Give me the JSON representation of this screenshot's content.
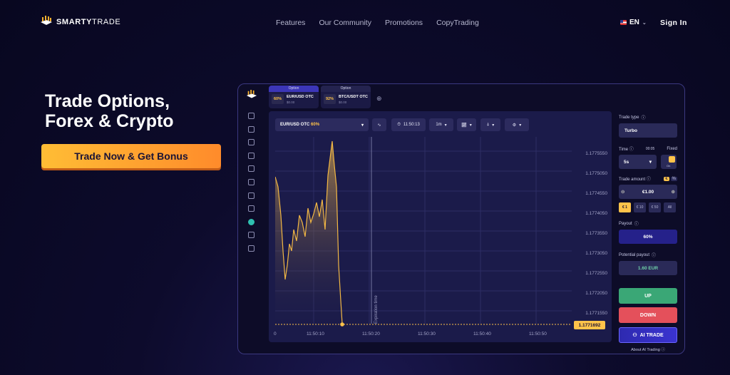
{
  "brand": {
    "name_bold": "SMARTY",
    "name_light": "TRADE"
  },
  "nav": [
    "Features",
    "Our Community",
    "Promotions",
    "CopyTrading"
  ],
  "language": "EN",
  "signin": "Sign In",
  "hero": {
    "title_line1": "Trade Options,",
    "title_line2": "Forex & Crypto",
    "cta": "Trade Now & Get Bonus"
  },
  "platform": {
    "tabs": [
      {
        "header": "Option",
        "pct": "60%",
        "name": "EUR/USD OTC",
        "balance": "$0.00"
      },
      {
        "header": "Option",
        "pct": "92%",
        "name": "BTC/USDT OTC",
        "balance": "$0.00"
      }
    ],
    "toolbar": {
      "asset": "EUR/USD OTC",
      "asset_pct": "60%",
      "clock": "11:50:13",
      "timeframe": "1m"
    },
    "price_axis": [
      "1.1775550",
      "1.1775050",
      "1.1774550",
      "1.1774050",
      "1.1773550",
      "1.1773050",
      "1.1772550",
      "1.1772050",
      "1.1771550"
    ],
    "time_axis": [
      "0",
      "11:50:10",
      "11:50:20",
      "11:50:30",
      "11:50:40",
      "11:50:50"
    ],
    "current_price": "1.1771692",
    "expiration_label": "Expiration time",
    "accent": "#ffc34a",
    "panel": {
      "trade_type_label": "Trade type",
      "trade_type": "Turbo",
      "time_label": "Time",
      "time_countdown": "00:05",
      "fixed_label": "Fixed",
      "time_value": "5s",
      "toggle_label": "On",
      "amount_label": "Trade amount",
      "amount_currency": "€",
      "amount_percent": "%",
      "amount": "€1.00",
      "chips": [
        "€ 1",
        "€ 10",
        "€ 50",
        "All"
      ],
      "payout_label": "Payout",
      "payout": "60%",
      "potential_label": "Potential payout",
      "potential": "1.60 EUR",
      "up": "UP",
      "down": "DOWN",
      "ai": "AI TRADE",
      "about_ai": "About AI Trading"
    }
  }
}
